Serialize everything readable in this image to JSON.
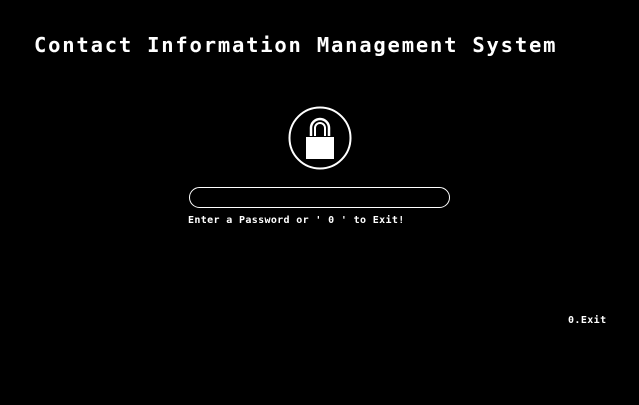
{
  "app": {
    "title": "Contact Information Management System"
  },
  "login": {
    "lock_icon": "lock-icon",
    "password_value": "",
    "hint": "Enter a Password or ' 0 ' to Exit!"
  },
  "menu": {
    "exit_label": "0.Exit"
  },
  "colors": {
    "background": "#000000",
    "foreground": "#ffffff"
  }
}
